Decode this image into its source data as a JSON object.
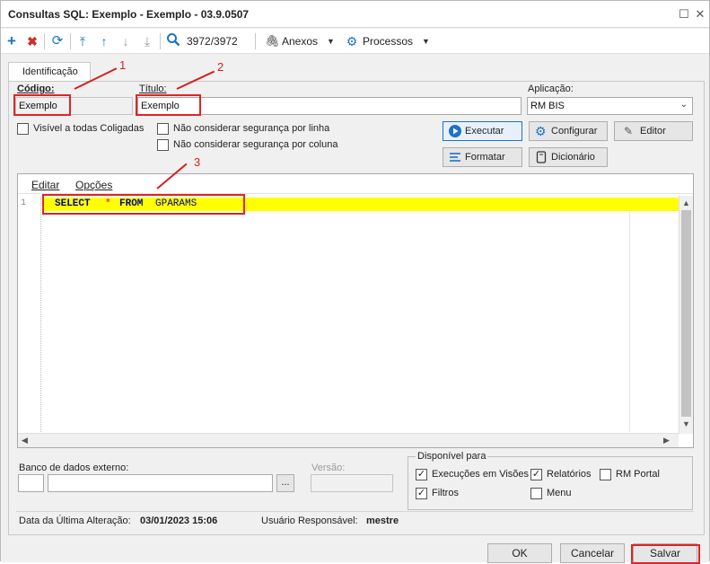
{
  "window": {
    "title": "Consultas SQL: Exemplo - Exemplo - 03.9.0507"
  },
  "toolbar": {
    "counter": "3972/3972",
    "anexos": "Anexos",
    "processos": "Processos"
  },
  "tabs": [
    {
      "label": "Identificação"
    }
  ],
  "form": {
    "codigo_label": "Código:",
    "codigo_value": "Exemplo",
    "titulo_label": "Título:",
    "titulo_value": "Exemplo",
    "aplicacao_label": "Aplicação:",
    "aplicacao_value": "RM BIS",
    "visivel_label": "Visível a todas Coligadas",
    "seg_linha_label": "Não considerar segurança por linha",
    "seg_coluna_label": "Não considerar segurança por coluna"
  },
  "actions": {
    "executar": "Executar",
    "configurar": "Configurar",
    "editor": "Editor",
    "formatar": "Formatar",
    "dicionario": "Dicionário"
  },
  "editor": {
    "menu": [
      "Editar",
      "Opções"
    ],
    "line_number": "1",
    "sql_keyword1": "SELECT",
    "sql_star": "*",
    "sql_keyword2": "FROM",
    "sql_table": "GPARAMS"
  },
  "bottom": {
    "banco_label": "Banco de dados externo:",
    "browse": "...",
    "versao_label": "Versão:",
    "disponivel_title": "Disponível para",
    "exec_visoes": "Execuções em Visões",
    "relatorios": "Relatórios",
    "rm_portal": "RM Portal",
    "filtros": "Filtros",
    "menu": "Menu",
    "data_label": "Data da Última Alteração:",
    "data_value": "03/01/2023 15:06",
    "usuario_label": "Usuário Responsável:",
    "usuario_value": "mestre"
  },
  "footer": {
    "ok": "OK",
    "cancelar": "Cancelar",
    "salvar": "Salvar"
  },
  "annotations": {
    "n1": "1",
    "n2": "2",
    "n3": "3"
  },
  "colors": {
    "accent": "#1a73c8",
    "highlight": "#ffff00",
    "annotation": "#d31f1f",
    "keyword": "#00008b"
  }
}
